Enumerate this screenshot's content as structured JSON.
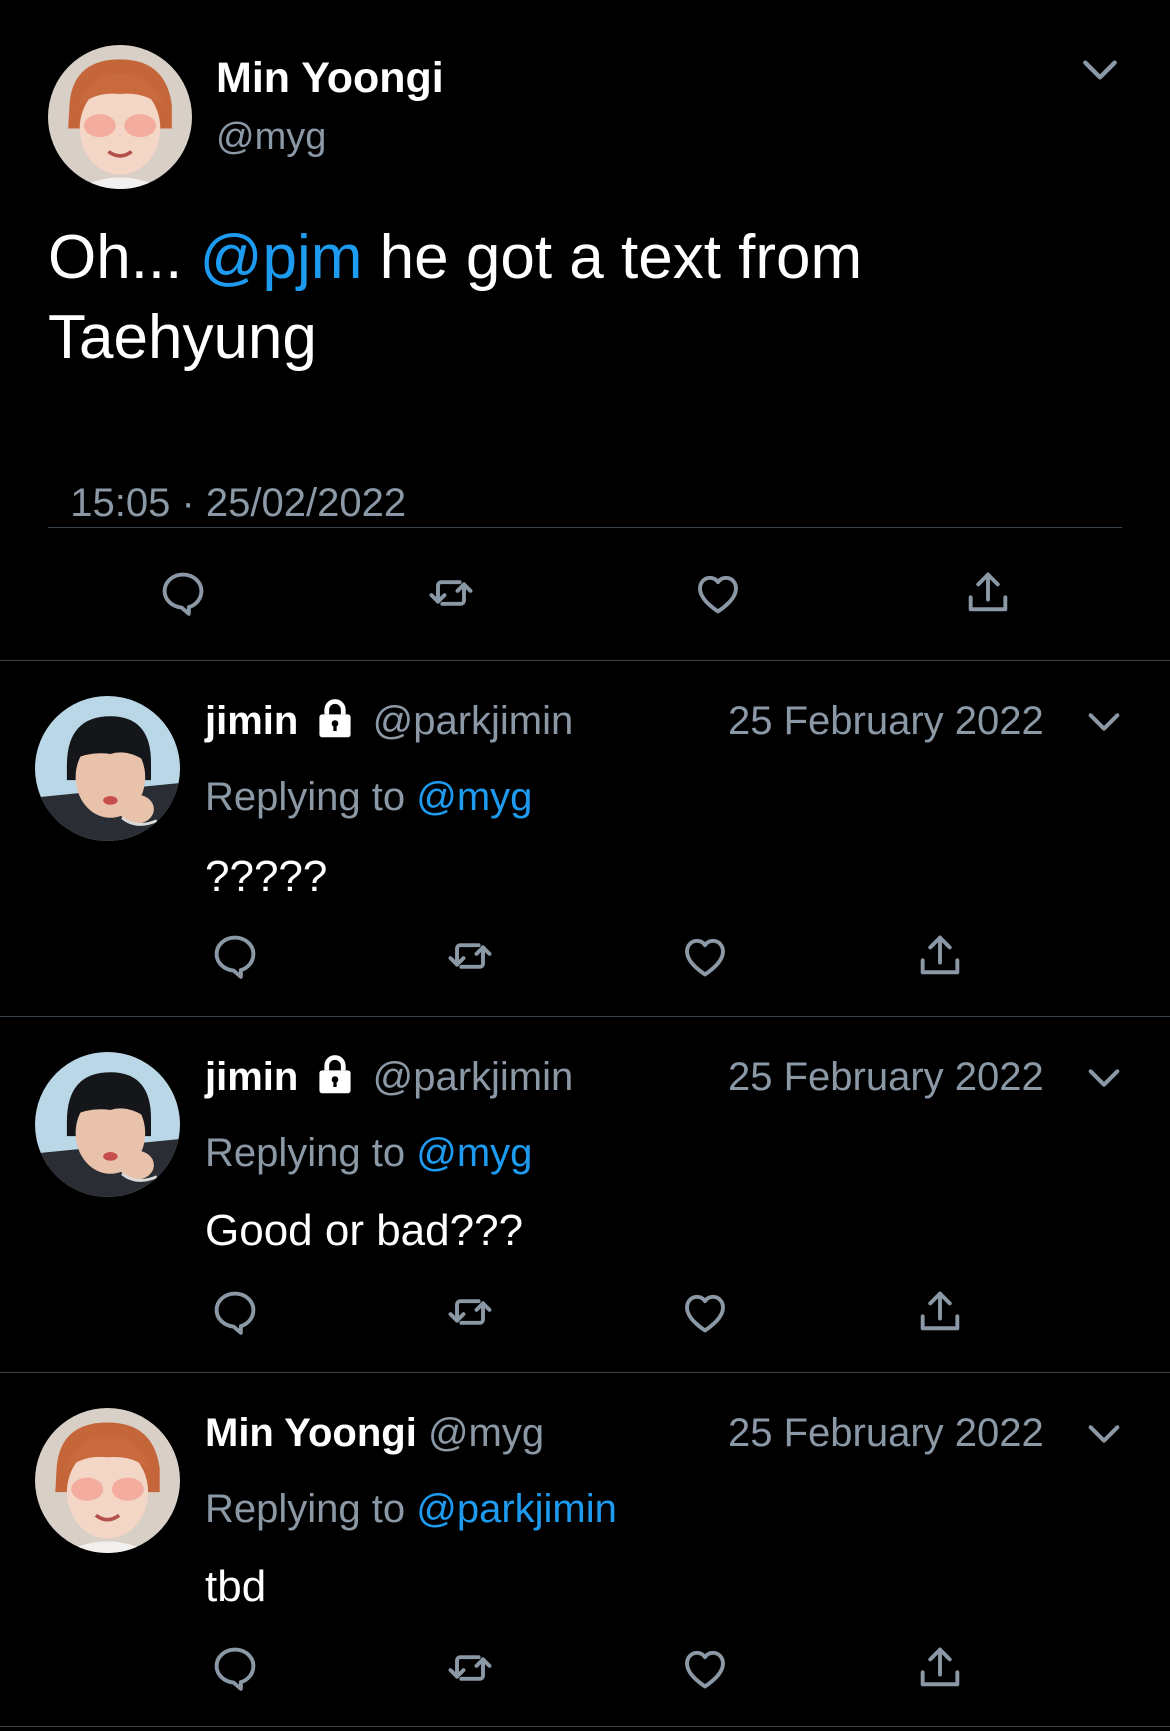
{
  "main_tweet": {
    "display_name": "Min Yoongi",
    "handle": "@myg",
    "text_prefix": "Oh... ",
    "mention": "@pjm",
    "text_suffix_line1": " he got a text from",
    "text_line2": "Taehyung",
    "time": "15:05",
    "separator": "·",
    "date": "25/02/2022"
  },
  "replies": [
    {
      "display_name": "jimin",
      "protected": true,
      "handle": "@parkjimin",
      "date": "25 February 2022",
      "replying_label": "Replying to ",
      "replying_to": "@myg",
      "text": "?????"
    },
    {
      "display_name": "jimin",
      "protected": true,
      "handle": "@parkjimin",
      "date": "25 February 2022",
      "replying_label": "Replying to ",
      "replying_to": "@myg",
      "text": "Good or bad???"
    },
    {
      "display_name": "Min Yoongi",
      "protected": false,
      "handle": "@myg",
      "date": "25 February 2022",
      "replying_label": "Replying to ",
      "replying_to": "@parkjimin",
      "text": "tbd"
    }
  ],
  "colors": {
    "background": "#000000",
    "text": "#ffffff",
    "muted": "#8b98a5",
    "link": "#1d9bf0",
    "divider": "#38444d"
  },
  "icons": [
    "chevron-down-icon",
    "reply-icon",
    "retweet-icon",
    "like-icon",
    "share-icon",
    "lock-icon"
  ]
}
